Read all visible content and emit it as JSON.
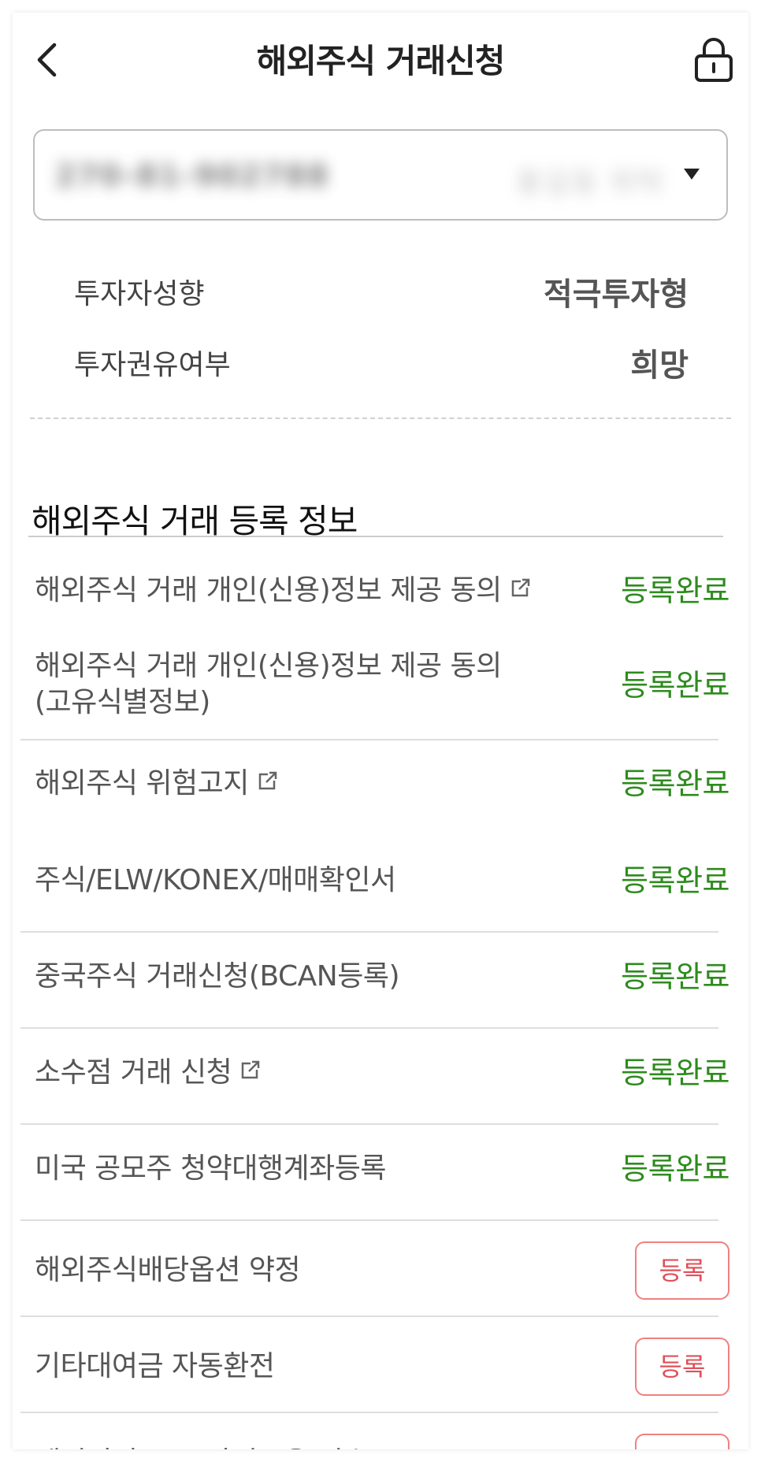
{
  "header": {
    "title": "해외주식 거래신청",
    "back_icon": "chevron-left-icon",
    "lock_icon": "lock-icon"
  },
  "account": {
    "number": "270-81-902788",
    "name": "홍길동 위탁",
    "dropdown_icon": "caret-down-icon"
  },
  "investor_info": [
    {
      "label": "투자자성향",
      "value": "적극투자형"
    },
    {
      "label": "투자권유여부",
      "value": "희망"
    }
  ],
  "section": {
    "title": "해외주식 거래 등록 정보",
    "items": [
      {
        "label": "해외주식 거래 개인(신용)정보 제공 동의",
        "external_link": true,
        "status": "등록완료"
      },
      {
        "label": "해외주식 거래 개인(신용)정보 제공 동의",
        "label2": "(고유식별정보)",
        "status": "등록완료"
      },
      {
        "label": "해외주식 위험고지",
        "external_link": true,
        "status": "등록완료"
      },
      {
        "label": "주식/ELW/KONEX/매매확인서",
        "status": "등록완료"
      },
      {
        "label": "중국주식 거래신청(BCAN등록)",
        "status": "등록완료"
      },
      {
        "label": "소수점 거래 신청",
        "external_link": true,
        "status": "등록완료"
      },
      {
        "label": "미국 공모주 청약대행계좌등록",
        "status": "등록완료"
      },
      {
        "label": "해외주식배당옵션 약정",
        "button": "등록"
      },
      {
        "label": "기타대여금 자동환전",
        "button": "등록"
      },
      {
        "label": "레버리지 ETP 사전교육 이수",
        "button": "등록"
      }
    ]
  },
  "colors": {
    "status_green": "#2e8b1e",
    "register_red": "#e0505a",
    "register_border": "#f08080"
  }
}
